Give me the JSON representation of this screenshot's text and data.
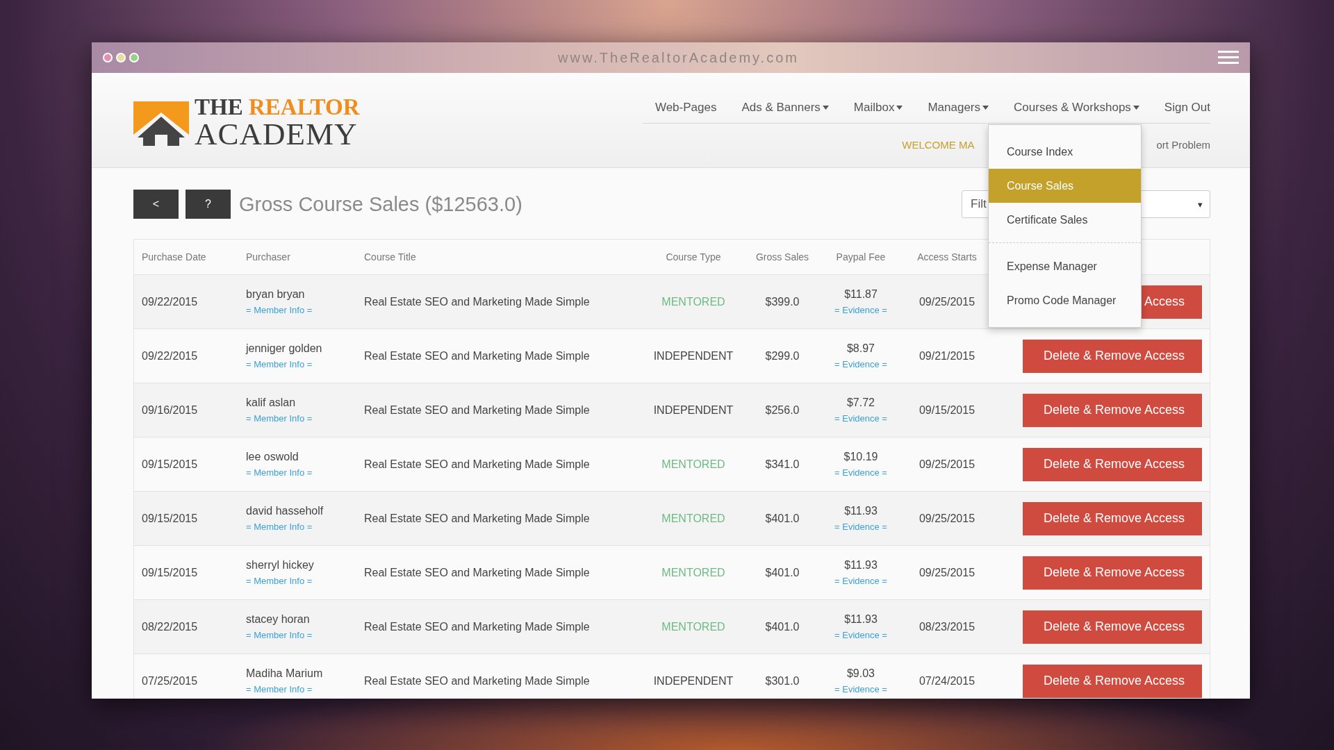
{
  "window": {
    "url": "www.TheRealtorAcademy.com"
  },
  "logo": {
    "word_1": "THE",
    "word_2": "REALTOR",
    "word_3": "ACADEMY"
  },
  "nav": [
    {
      "label": "Web-Pages",
      "caret": false
    },
    {
      "label": "Ads & Banners",
      "caret": true
    },
    {
      "label": "Mailbox",
      "caret": true
    },
    {
      "label": "Managers",
      "caret": true
    },
    {
      "label": "Courses & Workshops",
      "caret": true
    },
    {
      "label": "Sign Out",
      "caret": false
    }
  ],
  "subnav": {
    "welcome": "WELCOME MA",
    "report": "ort Problem"
  },
  "dropdown": {
    "groups": [
      [
        {
          "label": "Course Index",
          "selected": false
        },
        {
          "label": "Course Sales",
          "selected": true
        },
        {
          "label": "Certificate Sales",
          "selected": false
        }
      ],
      [
        {
          "label": "Expense Manager",
          "selected": false
        },
        {
          "label": "Promo Code Manager",
          "selected": false
        }
      ]
    ]
  },
  "toolbar": {
    "buttons": [
      "<",
      "?"
    ],
    "title": "Gross Course Sales ($12563.0)",
    "filter": {
      "placeholder": "Filt",
      "arrow": "▾"
    }
  },
  "table": {
    "columns": [
      "Purchase Date",
      "Purchaser",
      "Course Title",
      "Course Type",
      "Gross Sales",
      "Paypal Fee",
      "Access Starts"
    ],
    "rows": [
      {
        "date": "09/22/2015",
        "purchaser": "bryan bryan",
        "member_link": "= Member Info =",
        "title": "Real Estate SEO and Marketing Made Simple",
        "type": {
          "label": "MENTORED",
          "color": "#6dbb83"
        },
        "gross": "$399.0",
        "fee": "$11.87",
        "evidence_link": "= Evidence =",
        "access": "09/25/2015",
        "action": "Access"
      },
      {
        "date": "09/22/2015",
        "purchaser": "jenniger golden",
        "member_link": "= Member Info =",
        "title": "Real Estate SEO and Marketing Made Simple",
        "type": {
          "label": "INDEPENDENT",
          "color": "#444444"
        },
        "gross": "$299.0",
        "fee": "$8.97",
        "evidence_link": "= Evidence =",
        "access": "09/21/2015",
        "action": "Delete & Remove Access"
      },
      {
        "date": "09/16/2015",
        "purchaser": "kalif aslan",
        "member_link": "= Member Info =",
        "title": "Real Estate SEO and Marketing Made Simple",
        "type": {
          "label": "INDEPENDENT",
          "color": "#444444"
        },
        "gross": "$256.0",
        "fee": "$7.72",
        "evidence_link": "= Evidence =",
        "access": "09/15/2015",
        "action": "Delete & Remove Access"
      },
      {
        "date": "09/15/2015",
        "purchaser": "lee oswold",
        "member_link": "= Member Info =",
        "title": "Real Estate SEO and Marketing Made Simple",
        "type": {
          "label": "MENTORED",
          "color": "#6dbb83"
        },
        "gross": "$341.0",
        "fee": "$10.19",
        "evidence_link": "= Evidence =",
        "access": "09/25/2015",
        "action": "Delete & Remove Access"
      },
      {
        "date": "09/15/2015",
        "purchaser": "david hasseholf",
        "member_link": "= Member Info =",
        "title": "Real Estate SEO and Marketing Made Simple",
        "type": {
          "label": "MENTORED",
          "color": "#6dbb83"
        },
        "gross": "$401.0",
        "fee": "$11.93",
        "evidence_link": "= Evidence =",
        "access": "09/25/2015",
        "action": "Delete & Remove Access"
      },
      {
        "date": "09/15/2015",
        "purchaser": "sherryl hickey",
        "member_link": "= Member Info =",
        "title": "Real Estate SEO and Marketing Made Simple",
        "type": {
          "label": "MENTORED",
          "color": "#6dbb83"
        },
        "gross": "$401.0",
        "fee": "$11.93",
        "evidence_link": "= Evidence =",
        "access": "09/25/2015",
        "action": "Delete & Remove Access"
      },
      {
        "date": "08/22/2015",
        "purchaser": "stacey horan",
        "member_link": "= Member Info =",
        "title": "Real Estate SEO and Marketing Made Simple",
        "type": {
          "label": "MENTORED",
          "color": "#6dbb83"
        },
        "gross": "$401.0",
        "fee": "$11.93",
        "evidence_link": "= Evidence =",
        "access": "08/23/2015",
        "action": "Delete & Remove Access"
      },
      {
        "date": "07/25/2015",
        "purchaser": "Madiha Marium",
        "member_link": "= Member Info =",
        "title": "Real Estate SEO and Marketing Made Simple",
        "type": {
          "label": "INDEPENDENT",
          "color": "#444444"
        },
        "gross": "$301.0",
        "fee": "$9.03",
        "evidence_link": "= Evidence =",
        "access": "07/24/2015",
        "action": "Delete & Remove Access"
      }
    ]
  }
}
